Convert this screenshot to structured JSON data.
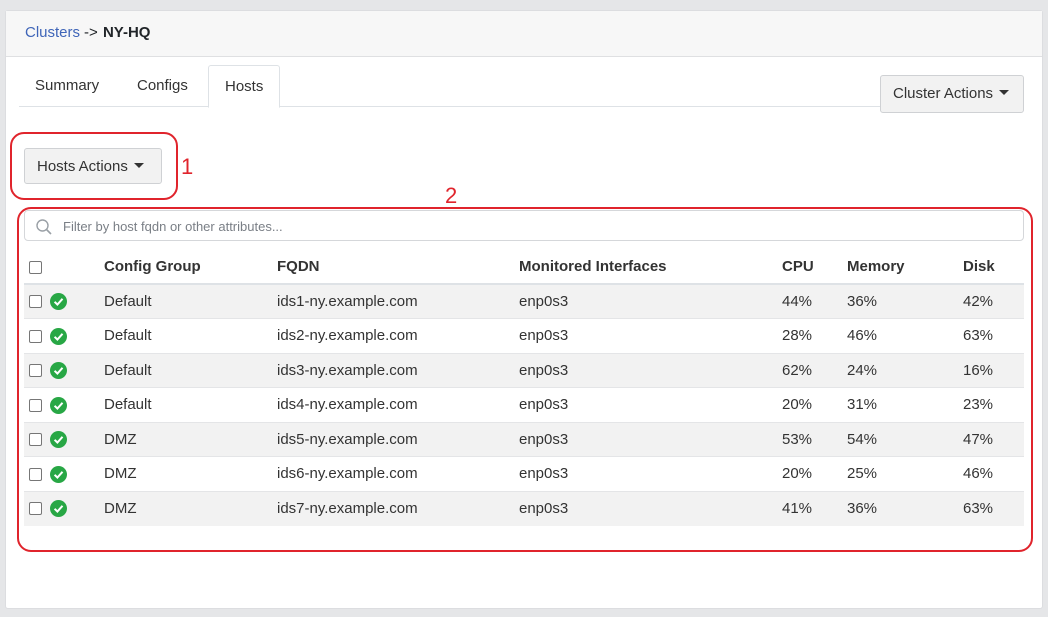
{
  "breadcrumb": {
    "parent": "Clusters",
    "separator": "->",
    "current": "NY-HQ"
  },
  "tabs": [
    {
      "label": "Summary",
      "active": false
    },
    {
      "label": "Configs",
      "active": false
    },
    {
      "label": "Hosts",
      "active": true
    }
  ],
  "cluster_actions_label": "Cluster Actions",
  "hosts_actions_label": "Hosts Actions",
  "annotations": [
    "1",
    "2"
  ],
  "filter": {
    "placeholder": "Filter by host fqdn or other attributes...",
    "value": ""
  },
  "table": {
    "headers": [
      "Config Group",
      "FQDN",
      "Monitored Interfaces",
      "CPU",
      "Memory",
      "Disk"
    ],
    "rows": [
      {
        "group": "Default",
        "fqdn": "ids1-ny.example.com",
        "iface": "enp0s3",
        "cpu": "44%",
        "mem": "36%",
        "disk": "42%"
      },
      {
        "group": "Default",
        "fqdn": "ids2-ny.example.com",
        "iface": "enp0s3",
        "cpu": "28%",
        "mem": "46%",
        "disk": "63%"
      },
      {
        "group": "Default",
        "fqdn": "ids3-ny.example.com",
        "iface": "enp0s3",
        "cpu": "62%",
        "mem": "24%",
        "disk": "16%"
      },
      {
        "group": "Default",
        "fqdn": "ids4-ny.example.com",
        "iface": "enp0s3",
        "cpu": "20%",
        "mem": "31%",
        "disk": "23%"
      },
      {
        "group": "DMZ",
        "fqdn": "ids5-ny.example.com",
        "iface": "enp0s3",
        "cpu": "53%",
        "mem": "54%",
        "disk": "47%"
      },
      {
        "group": "DMZ",
        "fqdn": "ids6-ny.example.com",
        "iface": "enp0s3",
        "cpu": "20%",
        "mem": "25%",
        "disk": "46%"
      },
      {
        "group": "DMZ",
        "fqdn": "ids7-ny.example.com",
        "iface": "enp0s3",
        "cpu": "41%",
        "mem": "36%",
        "disk": "63%"
      }
    ]
  },
  "colors": {
    "link": "#3f65b8",
    "status_ok": "#28a745",
    "metric": "#1f7a1f",
    "annotation": "#e0242c"
  },
  "icons": {
    "status": "check-circle-icon",
    "search": "search-icon"
  }
}
